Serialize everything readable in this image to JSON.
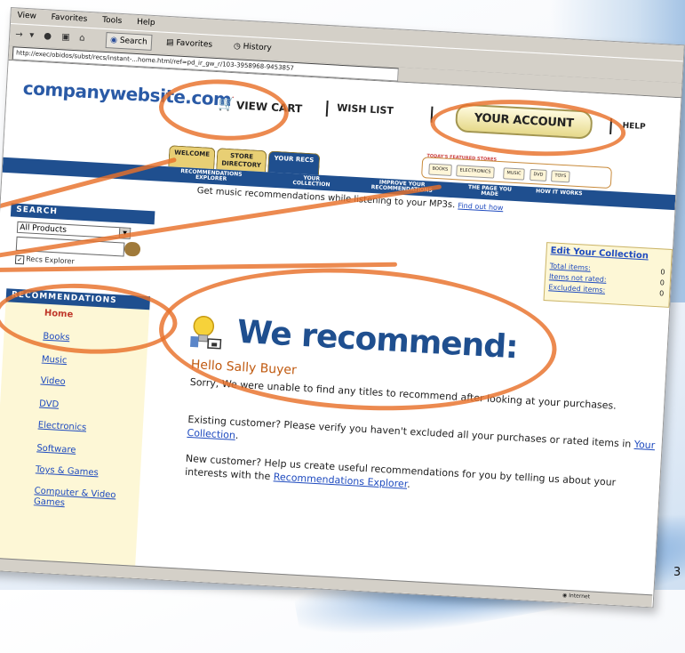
{
  "browser": {
    "menu": [
      "View",
      "Favorites",
      "Tools",
      "Help"
    ],
    "toolbar": {
      "search_label": "Search",
      "favorites_label": "Favorites",
      "history_label": "History"
    },
    "address": "http://exec/obidos/subst/recs/instant-...home.html/ref=pd_ir_gw_r/103-3958968-9453857",
    "status": {
      "zone": "Internet"
    }
  },
  "header": {
    "logo": "companywebsite.com",
    "view_cart": "VIEW CART",
    "wish_list": "WISH LIST",
    "your_account": "YOUR ACCOUNT",
    "help": "HELP"
  },
  "tabs": [
    {
      "label": "WELCOME"
    },
    {
      "label": "STORE DIRECTORY"
    },
    {
      "label": "YOUR RECS"
    }
  ],
  "stores": {
    "label": "TODAY'S FEATURED STORES",
    "items": [
      "BOOKS",
      "ELECTRONICS",
      "MUSIC",
      "DVD",
      "TOYS"
    ]
  },
  "nav": {
    "links": [
      "RECOMMENDATIONS EXPLORER",
      "YOUR COLLECTION",
      "IMPROVE YOUR RECOMMENDATIONS",
      "THE PAGE YOU MADE",
      "HOW IT WORKS"
    ]
  },
  "tagline": {
    "text": "Get music recommendations while listening to your MP3s.",
    "link": "Find out how"
  },
  "sidebar": {
    "search_head": "SEARCH",
    "product_select": "All Products",
    "checkbox_label": "Recs Explorer",
    "rec_head": "RECOMMENDATIONS",
    "items": [
      "Home",
      "Books",
      "Music",
      "Video",
      "DVD",
      "Electronics",
      "Software",
      "Toys & Games",
      "Computer & Video Games"
    ]
  },
  "collection": {
    "title": "Edit Your Collection",
    "rows": [
      {
        "label": "Total items:",
        "value": "0"
      },
      {
        "label": "Items not rated:",
        "value": "0"
      },
      {
        "label": "Excluded items:",
        "value": "0"
      }
    ]
  },
  "main": {
    "headline": "We recommend:",
    "greeting": "Hello Sally Buyer",
    "p1_start": "Sorry, We were unable to find any titles to recommend after looking at your purchases.",
    "p2_before": "Existing customer? Please verify you haven't excluded all your purchases or rated items in",
    "p2_link": "Your Collection",
    "p2_after": ".",
    "p3_before": "New customer? Help us create useful recommendations for you by telling us about your interests with the",
    "p3_link": "Recommendations Explorer",
    "p3_after": "."
  },
  "corner_number": "3",
  "colors": {
    "brand_blue": "#1f4f8f",
    "highlight_orange": "#e8702a",
    "tab_gold": "#e8cf74"
  }
}
